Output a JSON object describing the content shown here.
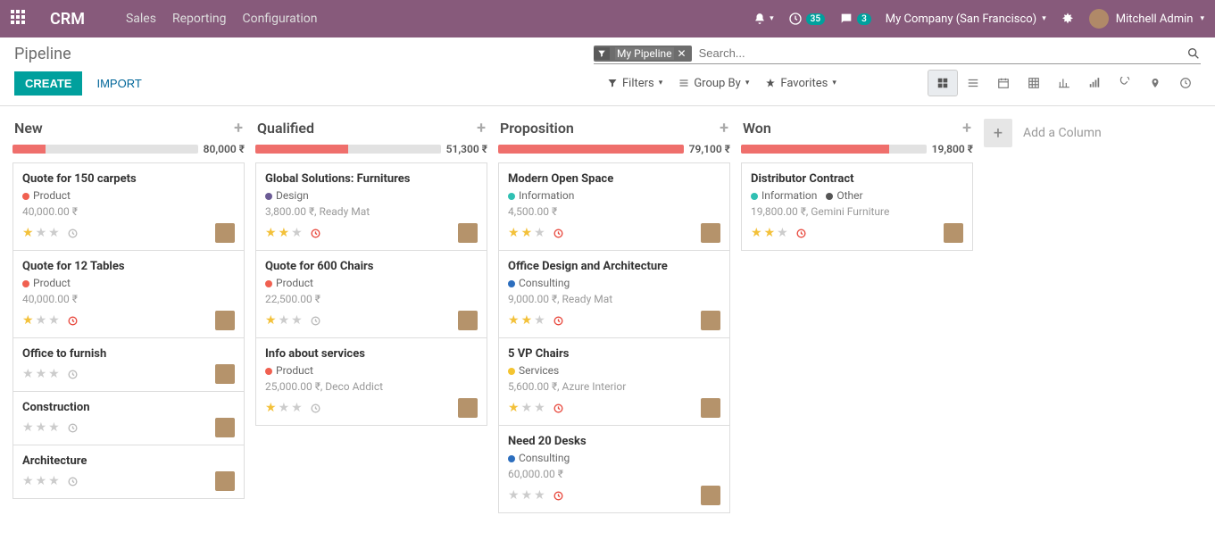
{
  "navbar": {
    "brand": "CRM",
    "links": [
      "Sales",
      "Reporting",
      "Configuration"
    ],
    "badge1": "35",
    "badge2": "3",
    "company": "My Company (San Francisco)",
    "user": "Mitchell Admin"
  },
  "page": {
    "title": "Pipeline",
    "create": "CREATE",
    "import": "IMPORT"
  },
  "search": {
    "tag": "My Pipeline",
    "placeholder": "Search..."
  },
  "toolbar": {
    "filters": "Filters",
    "groupby": "Group By",
    "favorites": "Favorites"
  },
  "add_column": "Add a Column",
  "columns": [
    {
      "title": "New",
      "amount": "80,000 ₹",
      "progress": 18,
      "cards": [
        {
          "title": "Quote for 150 carpets",
          "tags": [
            {
              "color": "red",
              "label": "Product"
            }
          ],
          "subtitle": "40,000.00 ₹",
          "stars": 1,
          "clock": "grey"
        },
        {
          "title": "Quote for 12 Tables",
          "tags": [
            {
              "color": "red",
              "label": "Product"
            }
          ],
          "subtitle": "40,000.00 ₹",
          "stars": 1,
          "clock": "red"
        },
        {
          "title": "Office to furnish",
          "tags": [],
          "subtitle": "",
          "stars": 0,
          "clock": "grey"
        },
        {
          "title": "Construction",
          "tags": [],
          "subtitle": "",
          "stars": 0,
          "clock": "grey"
        },
        {
          "title": "Architecture",
          "tags": [],
          "subtitle": "",
          "stars": 0,
          "clock": "grey"
        }
      ]
    },
    {
      "title": "Qualified",
      "amount": "51,300 ₹",
      "progress": 50,
      "cards": [
        {
          "title": "Global Solutions: Furnitures",
          "tags": [
            {
              "color": "purple",
              "label": "Design"
            }
          ],
          "subtitle": "3,800.00 ₹, Ready Mat",
          "stars": 2,
          "clock": "red"
        },
        {
          "title": "Quote for 600 Chairs",
          "tags": [
            {
              "color": "red",
              "label": "Product"
            }
          ],
          "subtitle": "22,500.00 ₹",
          "stars": 1,
          "clock": "grey"
        },
        {
          "title": "Info about services",
          "tags": [
            {
              "color": "red",
              "label": "Product"
            }
          ],
          "subtitle": "25,000.00 ₹, Deco Addict",
          "stars": 1,
          "clock": "grey"
        }
      ]
    },
    {
      "title": "Proposition",
      "amount": "79,100 ₹",
      "progress": 100,
      "cards": [
        {
          "title": "Modern Open Space",
          "tags": [
            {
              "color": "teal",
              "label": "Information"
            }
          ],
          "subtitle": "4,500.00 ₹",
          "stars": 2,
          "clock": "red"
        },
        {
          "title": "Office Design and Architecture",
          "tags": [
            {
              "color": "blue",
              "label": "Consulting"
            }
          ],
          "subtitle": "9,000.00 ₹, Ready Mat",
          "stars": 2,
          "clock": "red"
        },
        {
          "title": "5 VP Chairs",
          "tags": [
            {
              "color": "yellow",
              "label": "Services"
            }
          ],
          "subtitle": "5,600.00 ₹, Azure Interior",
          "stars": 1,
          "clock": "red"
        },
        {
          "title": "Need 20 Desks",
          "tags": [
            {
              "color": "blue",
              "label": "Consulting"
            }
          ],
          "subtitle": "60,000.00 ₹",
          "stars": 0,
          "clock": "red"
        }
      ]
    },
    {
      "title": "Won",
      "amount": "19,800 ₹",
      "progress": 80,
      "cards": [
        {
          "title": "Distributor Contract",
          "tags": [
            {
              "color": "teal",
              "label": "Information"
            },
            {
              "color": "dark",
              "label": "Other"
            }
          ],
          "subtitle": "19,800.00 ₹, Gemini Furniture",
          "stars": 2,
          "clock": "red"
        }
      ]
    }
  ]
}
